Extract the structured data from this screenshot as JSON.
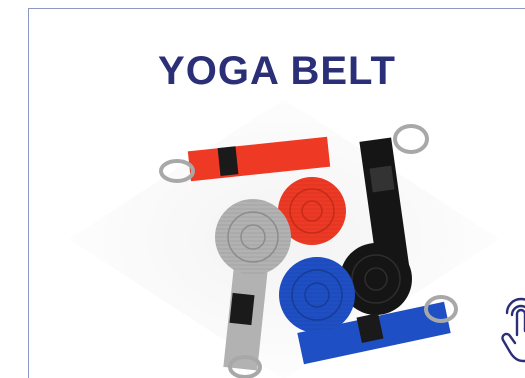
{
  "product": {
    "title": "YOGA BELT",
    "image_name": "yoga-belt-straps-photo",
    "colors": {
      "title": "#2a2f78",
      "red": "#ee3a25",
      "black": "#151515",
      "gray": "#b2b2b2",
      "blue": "#1f4fc4",
      "border": "#8e96c8",
      "tap_icon": "#2a2f78"
    },
    "icons": [
      "tap-hand-icon"
    ]
  }
}
